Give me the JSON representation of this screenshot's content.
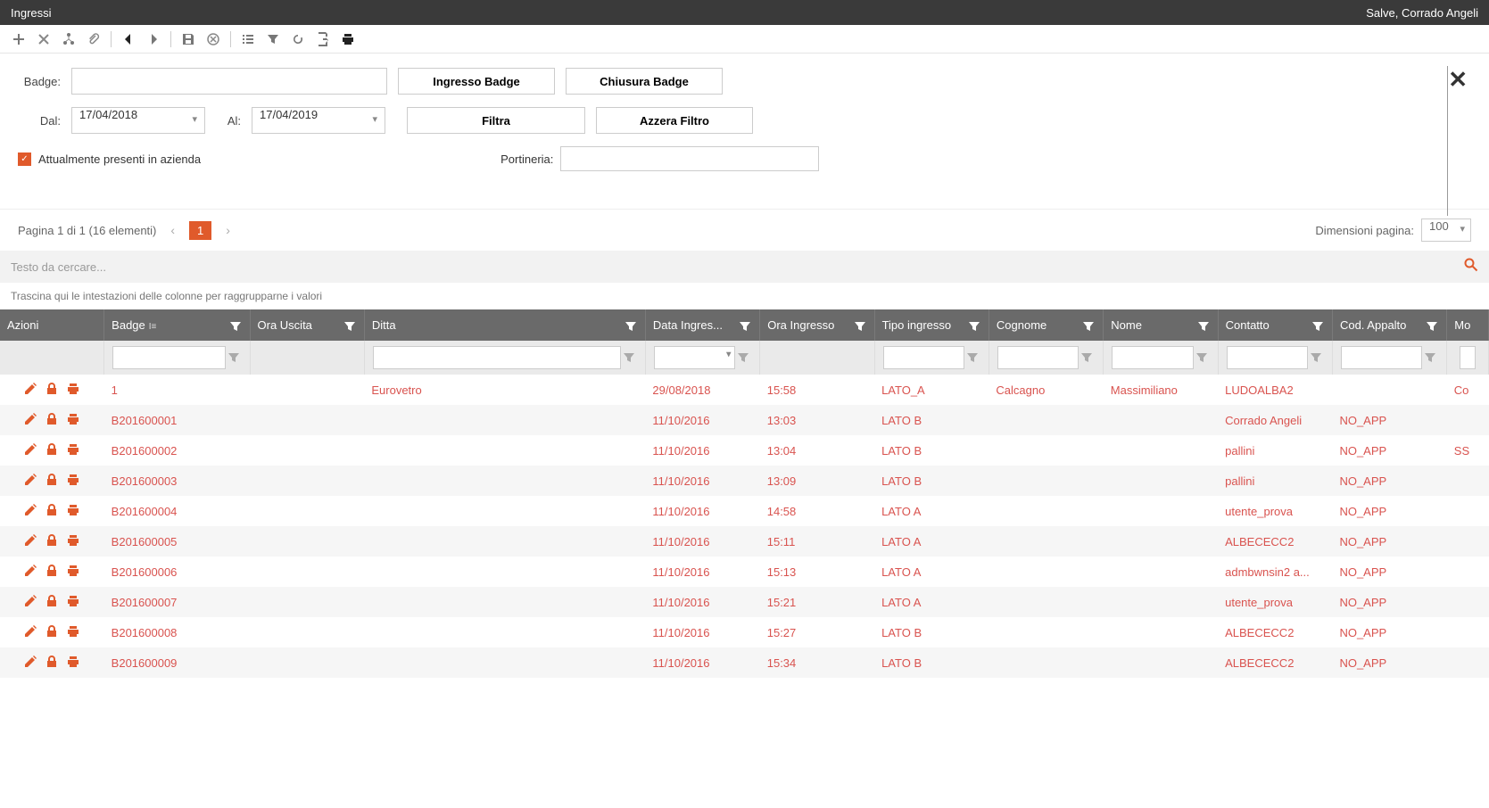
{
  "header": {
    "title": "Ingressi",
    "user_greeting": "Salve, Corrado Angeli"
  },
  "filters": {
    "badge_label": "Badge:",
    "badge_value": "",
    "dal_label": "Dal:",
    "dal_value": "17/04/2018",
    "al_label": "Al:",
    "al_value": "17/04/2019",
    "ingresso_btn": "Ingresso Badge",
    "chiusura_btn": "Chiusura Badge",
    "filtra_btn": "Filtra",
    "azzera_btn": "Azzera Filtro",
    "presenti_label": "Attualmente presenti in azienda",
    "presenti_checked": true,
    "portineria_label": "Portineria:",
    "portineria_value": ""
  },
  "pagination": {
    "summary": "Pagina 1 di 1 (16 elementi)",
    "current": "1",
    "size_label": "Dimensioni pagina:",
    "size_value": "100"
  },
  "search": {
    "placeholder": "Testo da cercare..."
  },
  "group_hint": "Trascina qui le intestazioni delle colonne per raggrupparne i valori",
  "columns": {
    "actions": "Azioni",
    "badge": "Badge",
    "ora_uscita": "Ora Uscita",
    "ditta": "Ditta",
    "data_ing": "Data Ingres...",
    "ora_ing": "Ora Ingresso",
    "tipo": "Tipo ingresso",
    "cognome": "Cognome",
    "nome": "Nome",
    "contatto": "Contatto",
    "cod_appalto": "Cod. Appalto",
    "extra": "Mo"
  },
  "rows": [
    {
      "badge": "1",
      "ditta": "Eurovetro",
      "data": "29/08/2018",
      "ora": "15:58",
      "tipo": "LATO_A",
      "cognome": "Calcagno",
      "nome": "Massimiliano",
      "contatto": "LUDOALBA2",
      "cod": "",
      "extra": "Co"
    },
    {
      "badge": "B201600001",
      "ditta": "",
      "data": "11/10/2016",
      "ora": "13:03",
      "tipo": "LATO B",
      "cognome": "",
      "nome": "",
      "contatto": "Corrado Angeli",
      "cod": "NO_APP",
      "extra": ""
    },
    {
      "badge": "B201600002",
      "ditta": "",
      "data": "11/10/2016",
      "ora": "13:04",
      "tipo": "LATO B",
      "cognome": "",
      "nome": "",
      "contatto": "pallini",
      "cod": "NO_APP",
      "extra": "SS"
    },
    {
      "badge": "B201600003",
      "ditta": "",
      "data": "11/10/2016",
      "ora": "13:09",
      "tipo": "LATO B",
      "cognome": "",
      "nome": "",
      "contatto": "pallini",
      "cod": "NO_APP",
      "extra": ""
    },
    {
      "badge": "B201600004",
      "ditta": "",
      "data": "11/10/2016",
      "ora": "14:58",
      "tipo": "LATO A",
      "cognome": "",
      "nome": "",
      "contatto": "utente_prova",
      "cod": "NO_APP",
      "extra": ""
    },
    {
      "badge": "B201600005",
      "ditta": "",
      "data": "11/10/2016",
      "ora": "15:11",
      "tipo": "LATO A",
      "cognome": "",
      "nome": "",
      "contatto": "ALBECECC2",
      "cod": "NO_APP",
      "extra": ""
    },
    {
      "badge": "B201600006",
      "ditta": "",
      "data": "11/10/2016",
      "ora": "15:13",
      "tipo": "LATO A",
      "cognome": "",
      "nome": "",
      "contatto": "admbwnsin2 a...",
      "cod": "NO_APP",
      "extra": ""
    },
    {
      "badge": "B201600007",
      "ditta": "",
      "data": "11/10/2016",
      "ora": "15:21",
      "tipo": "LATO A",
      "cognome": "",
      "nome": "",
      "contatto": "utente_prova",
      "cod": "NO_APP",
      "extra": ""
    },
    {
      "badge": "B201600008",
      "ditta": "",
      "data": "11/10/2016",
      "ora": "15:27",
      "tipo": "LATO B",
      "cognome": "",
      "nome": "",
      "contatto": "ALBECECC2",
      "cod": "NO_APP",
      "extra": ""
    },
    {
      "badge": "B201600009",
      "ditta": "",
      "data": "11/10/2016",
      "ora": "15:34",
      "tipo": "LATO B",
      "cognome": "",
      "nome": "",
      "contatto": "ALBECECC2",
      "cod": "NO_APP",
      "extra": ""
    }
  ]
}
